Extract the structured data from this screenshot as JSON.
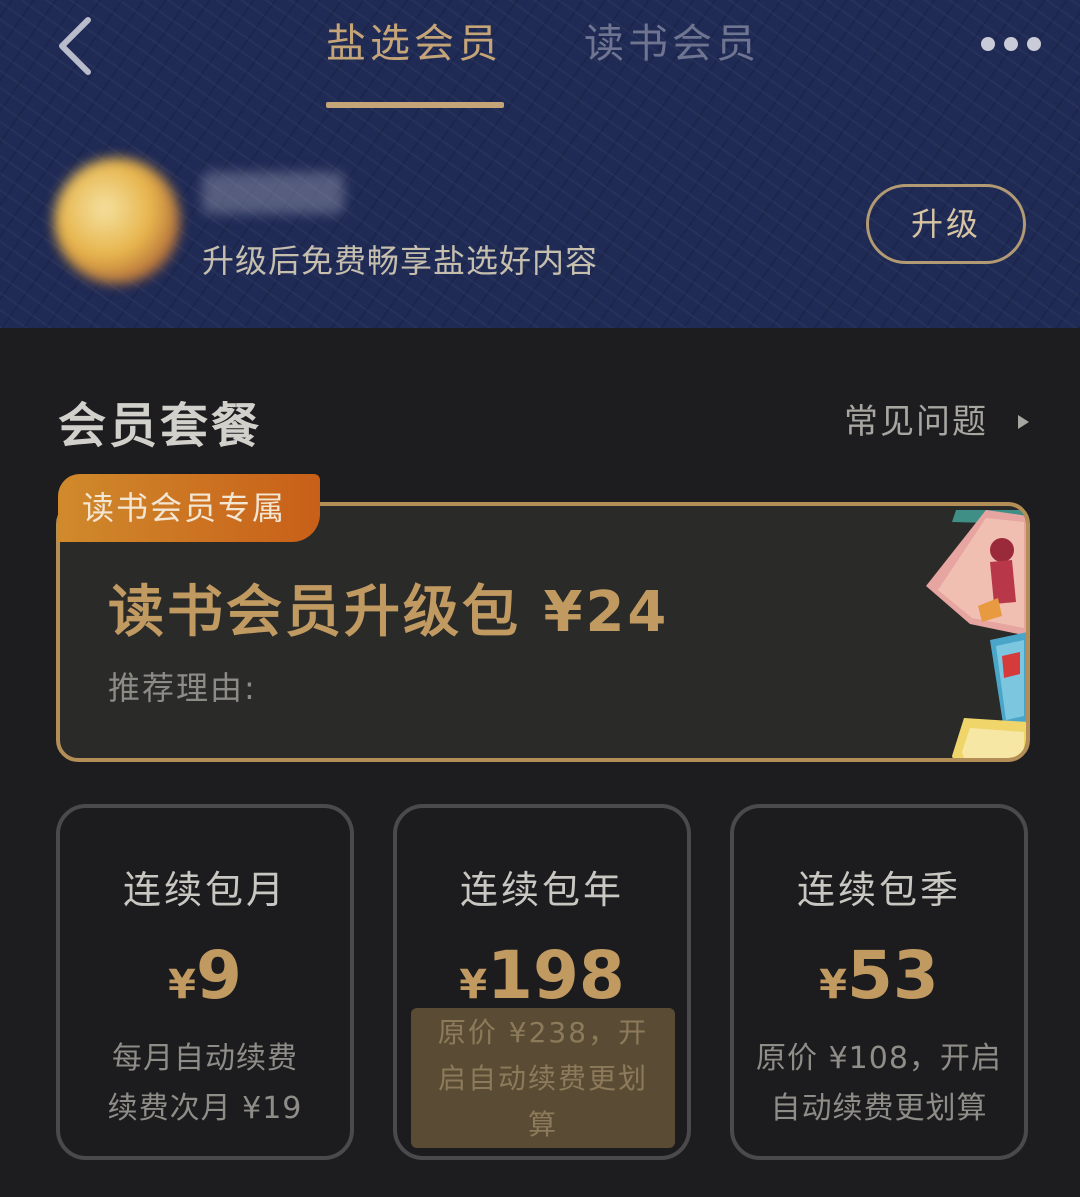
{
  "header": {
    "tabs": [
      {
        "label": "盐选会员",
        "active": true
      },
      {
        "label": "读书会员",
        "active": false
      }
    ],
    "icons": {
      "back": "chevron-left-icon",
      "more": "more-horizontal-icon"
    },
    "user": {
      "name": "",
      "subtitle": "升级后免费畅享盐选好内容"
    },
    "upgrade_label": "升级"
  },
  "section": {
    "title": "会员套餐",
    "faq_label": "常见问题"
  },
  "featured": {
    "badge": "读书会员专属",
    "title": "读书会员升级包 ¥24",
    "subtitle": "推荐理由:"
  },
  "plans": [
    {
      "name": "连续包月",
      "currency": "¥",
      "price": "9",
      "desc_line1": "每月自动续费",
      "desc_line2": "续费次月 ¥19"
    },
    {
      "name": "连续包年",
      "currency": "¥",
      "price": "198",
      "desc": "原价 ¥238，开启自动续费更划算"
    },
    {
      "name": "连续包季",
      "currency": "¥",
      "price": "53",
      "desc": "原价 ¥108，开启自动续费更划算"
    }
  ],
  "colors": {
    "gold": "#c19a62",
    "header_bg": "#1f2a55",
    "page_bg": "#1d1d1f",
    "badge_orange": "#c85f18"
  }
}
